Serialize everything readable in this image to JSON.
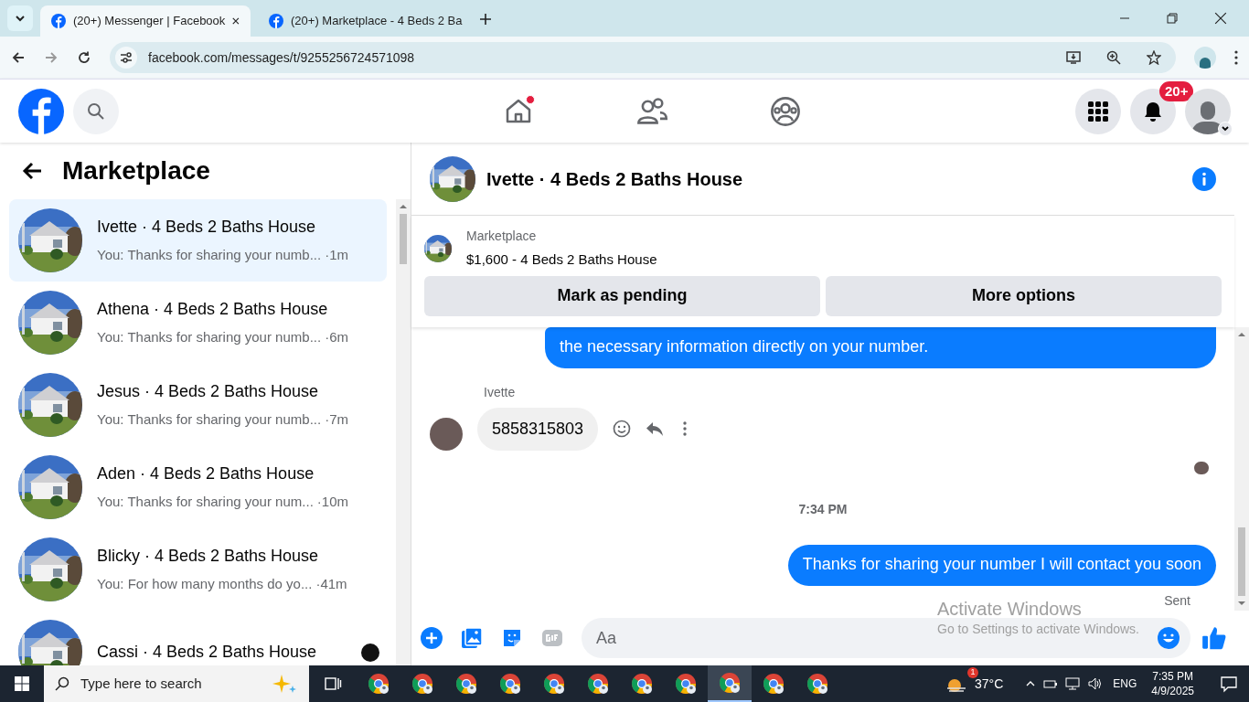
{
  "browser": {
    "tabs": [
      {
        "title": "(20+) Messenger | Facebook",
        "selected": true
      },
      {
        "title": "(20+) Marketplace - 4 Beds 2 Ba",
        "selected": false
      }
    ],
    "url": "facebook.com/messages/t/9255256724571098"
  },
  "topbar": {
    "notification_count": "20+",
    "home_dot": true
  },
  "sidebar": {
    "title": "Marketplace",
    "items": [
      {
        "title": "Ivette · 4 Beds 2 Baths House",
        "preview": "You: Thanks for sharing your numb...",
        "time": "·1m",
        "selected": true
      },
      {
        "title": "Athena · 4 Beds 2 Baths House",
        "preview": "You: Thanks for sharing your numb...",
        "time": "·6m",
        "selected": false
      },
      {
        "title": "Jesus · 4 Beds 2 Baths House",
        "preview": "You: Thanks for sharing your numb...",
        "time": "·7m",
        "selected": false
      },
      {
        "title": "Aden · 4 Beds 2 Baths House",
        "preview": "You: Thanks for sharing your num...",
        "time": "·10m",
        "selected": false
      },
      {
        "title": "Blicky · 4 Beds 2 Baths House",
        "preview": "You: For how many months do yo...",
        "time": "·41m",
        "selected": false
      },
      {
        "title": "Cassi · 4 Beds 2 Baths House",
        "selected": false
      }
    ]
  },
  "chat": {
    "title": "Ivette · 4 Beds 2 Baths House",
    "listing": {
      "label": "Marketplace",
      "title": "$1,600 - 4 Beds 2 Baths House",
      "buttons": [
        "Mark as pending",
        "More options"
      ]
    },
    "messages": [
      {
        "kind": "outgoing",
        "text": "the necessary information directly on your number."
      },
      {
        "kind": "incoming",
        "sender": "Ivette",
        "text": "5858315803"
      },
      {
        "kind": "receipt"
      },
      {
        "kind": "time",
        "text": "7:34 PM"
      },
      {
        "kind": "outgoing",
        "text": "Thanks for sharing your number I will contact you soon",
        "status": "Sent"
      }
    ],
    "composer": {
      "placeholder": "Aa"
    }
  },
  "activation": {
    "title": "Activate Windows",
    "text": "Go to Settings to activate Windows."
  },
  "taskbar": {
    "search_placeholder": "Type here to search",
    "apps": [
      {
        "selected": false
      },
      {
        "selected": false
      },
      {
        "selected": false
      },
      {
        "selected": false
      },
      {
        "selected": false
      },
      {
        "selected": false
      },
      {
        "selected": false
      },
      {
        "selected": false
      },
      {
        "selected": true
      },
      {
        "selected": false
      },
      {
        "selected": false
      }
    ],
    "weather_badge": "1",
    "temperature": "37°C",
    "language": "ENG",
    "time": "7:35 PM",
    "date": "4/9/2025"
  }
}
